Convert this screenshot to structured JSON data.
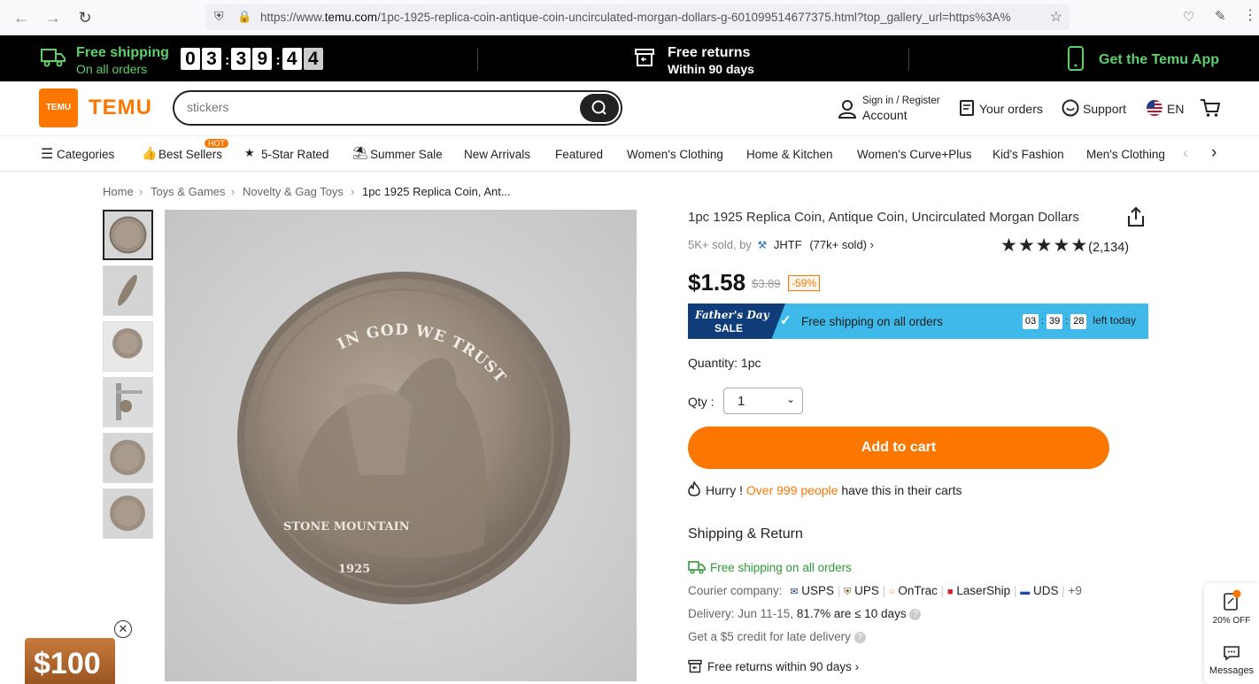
{
  "browser": {
    "url_prefix": "https://www.",
    "url_domain": "temu.com",
    "url_rest": "/1pc-1925-replica-coin-antique-coin-uncirculated-morgan-dollars-g-601099514677375.html?top_gallery_url=https%3A%"
  },
  "promo": {
    "free_shipping": "Free shipping",
    "on_all_orders": "On all orders",
    "countdown": [
      "0",
      "3",
      "3",
      "9",
      "4",
      "4"
    ],
    "free_returns": "Free returns",
    "within_days": "Within 90 days",
    "get_app": "Get the Temu App"
  },
  "header": {
    "logo_text": "TEMU",
    "logo_box_text": "TEMU",
    "search_placeholder": "stickers",
    "sign_in": "Sign in / Register",
    "account": "Account",
    "your_orders": "Your orders",
    "support": "Support",
    "language": "EN"
  },
  "categories": {
    "items": [
      "Categories",
      "Best Sellers",
      "5-Star Rated",
      "Summer Sale",
      "New Arrivals",
      "Featured",
      "Women's Clothing",
      "Home & Kitchen",
      "Women's Curve+Plus",
      "Kid's Fashion",
      "Men's Clothing"
    ],
    "hot_badge": "HOT"
  },
  "breadcrumb": [
    "Home",
    "Toys & Games",
    "Novelty & Gag Toys",
    "1pc 1925 Replica Coin, Ant..."
  ],
  "product": {
    "title": "1pc 1925 Replica Coin, Antique Coin, Uncirculated Morgan Dollars",
    "sold": "5K+ sold, by",
    "store": "JHTF",
    "store_sold": "(77k+ sold)",
    "rating_count": "(2,134)",
    "rating": 5,
    "price": "$1.58",
    "original_price": "$3.89",
    "discount": "-59%",
    "coin_text_top": "IN GOD WE TRUST",
    "coin_text_left": "STONE MOUNTAIN",
    "coin_year": "1925"
  },
  "sale_banner": {
    "title_line1": "Father's Day",
    "title_line2": "SALE",
    "text": "Free shipping on all orders",
    "timer": [
      "03",
      "39",
      "28"
    ],
    "left_today": "left today"
  },
  "purchase": {
    "quantity_label": "Quantity: 1pc",
    "qty_label": "Qty :",
    "qty_value": "1",
    "add_to_cart": "Add to cart",
    "hurry": "Hurry !",
    "hurry_highlight": "Over 999 people",
    "hurry_rest": "have this in their carts"
  },
  "shipping": {
    "title": "Shipping & Return",
    "free_shipping": "Free shipping on all orders",
    "courier_label": "Courier company:",
    "couriers": [
      "USPS",
      "UPS",
      "OnTrac",
      "LaserShip",
      "UDS"
    ],
    "more": "+9",
    "delivery_label": "Delivery: Jun 11-15,",
    "delivery_stat": "81.7% are ≤ 10 days",
    "credit": "Get a $5 credit for late delivery",
    "returns": "Free returns within 90 days"
  },
  "floating": {
    "off": "20% OFF",
    "messages": "Messages"
  },
  "coupon": {
    "amount": "$100"
  },
  "colors": {
    "brand": "#fb7701",
    "promo_green": "#5fcf6a",
    "sale_blue": "#3fb8ea"
  }
}
